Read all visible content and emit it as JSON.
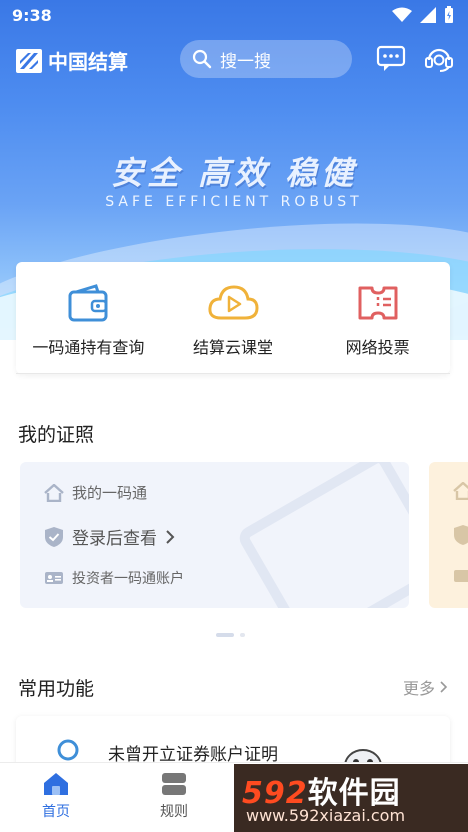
{
  "status_bar": {
    "time": "9:38"
  },
  "header": {
    "logo_text": "中国结算",
    "search_placeholder": "搜一搜"
  },
  "banner": {
    "slogan_cn": "安全 高效 稳健",
    "slogan_en": "SAFE EFFICIENT ROBUST"
  },
  "quick_actions": [
    {
      "label": "一码通持有查询",
      "icon": "wallet-icon",
      "color": "#3f8fd8"
    },
    {
      "label": "结算云课堂",
      "icon": "cloud-play-icon",
      "color": "#f0b23a"
    },
    {
      "label": "网络投票",
      "icon": "ticket-icon",
      "color": "#e06060"
    }
  ],
  "my_license": {
    "title": "我的证照",
    "card": {
      "heading": "我的一码通",
      "action": "登录后查看",
      "account": "投资者一码通账户"
    }
  },
  "common_functions": {
    "title": "常用功能",
    "more": "更多",
    "item": "未曾开立证券账户证明"
  },
  "bottom_nav": [
    {
      "label": "首页",
      "icon": "home-icon",
      "active": true
    },
    {
      "label": "规则",
      "icon": "rules-icon",
      "active": false
    }
  ],
  "watermark": {
    "brand_num": "592",
    "brand_cn": "软件园",
    "url": "www.592xiazai.com"
  },
  "colors": {
    "primary": "#3a78e6",
    "active_tab": "#2f6fe0"
  }
}
